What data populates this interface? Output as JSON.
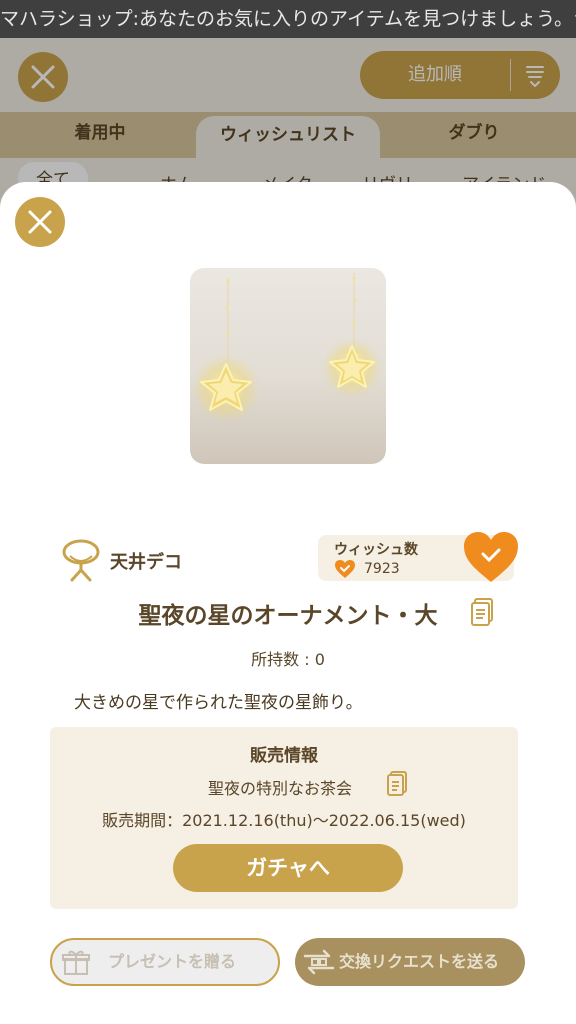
{
  "marquee": {
    "text": "マハラショップ:あなたのお気に入りのアイテムを見つけましょう。ショ"
  },
  "header": {
    "sort_label": "追加順"
  },
  "tabs": [
    {
      "label": "着用中"
    },
    {
      "label": "ウィッシュリスト"
    },
    {
      "label": "ダブり"
    }
  ],
  "categories": [
    {
      "label": "全て"
    },
    {
      "label": "ホム"
    },
    {
      "label": "メイク"
    },
    {
      "label": "リヴリー"
    },
    {
      "label": "アイランド"
    }
  ],
  "item": {
    "category": "天井デコ",
    "wish_label": "ウィッシュ数",
    "wish_count": "7923",
    "name": "聖夜の星のオーナメント・大",
    "owned": "所持数 : 0",
    "description": "大きめの星で作られた聖夜の星飾り。"
  },
  "sale": {
    "title": "販売情報",
    "event": "聖夜の特別なお茶会",
    "period": "販売期間：2021.12.16(thu)〜2022.06.15(wed)",
    "button": "ガチャへ"
  },
  "actions": {
    "present": "プレゼントを贈る",
    "exchange": "交換リクエストを送る"
  },
  "colors": {
    "accent": "#c9a24c",
    "heart": "#f08c1e",
    "text": "#5a4628",
    "panel": "#f6efe4"
  }
}
